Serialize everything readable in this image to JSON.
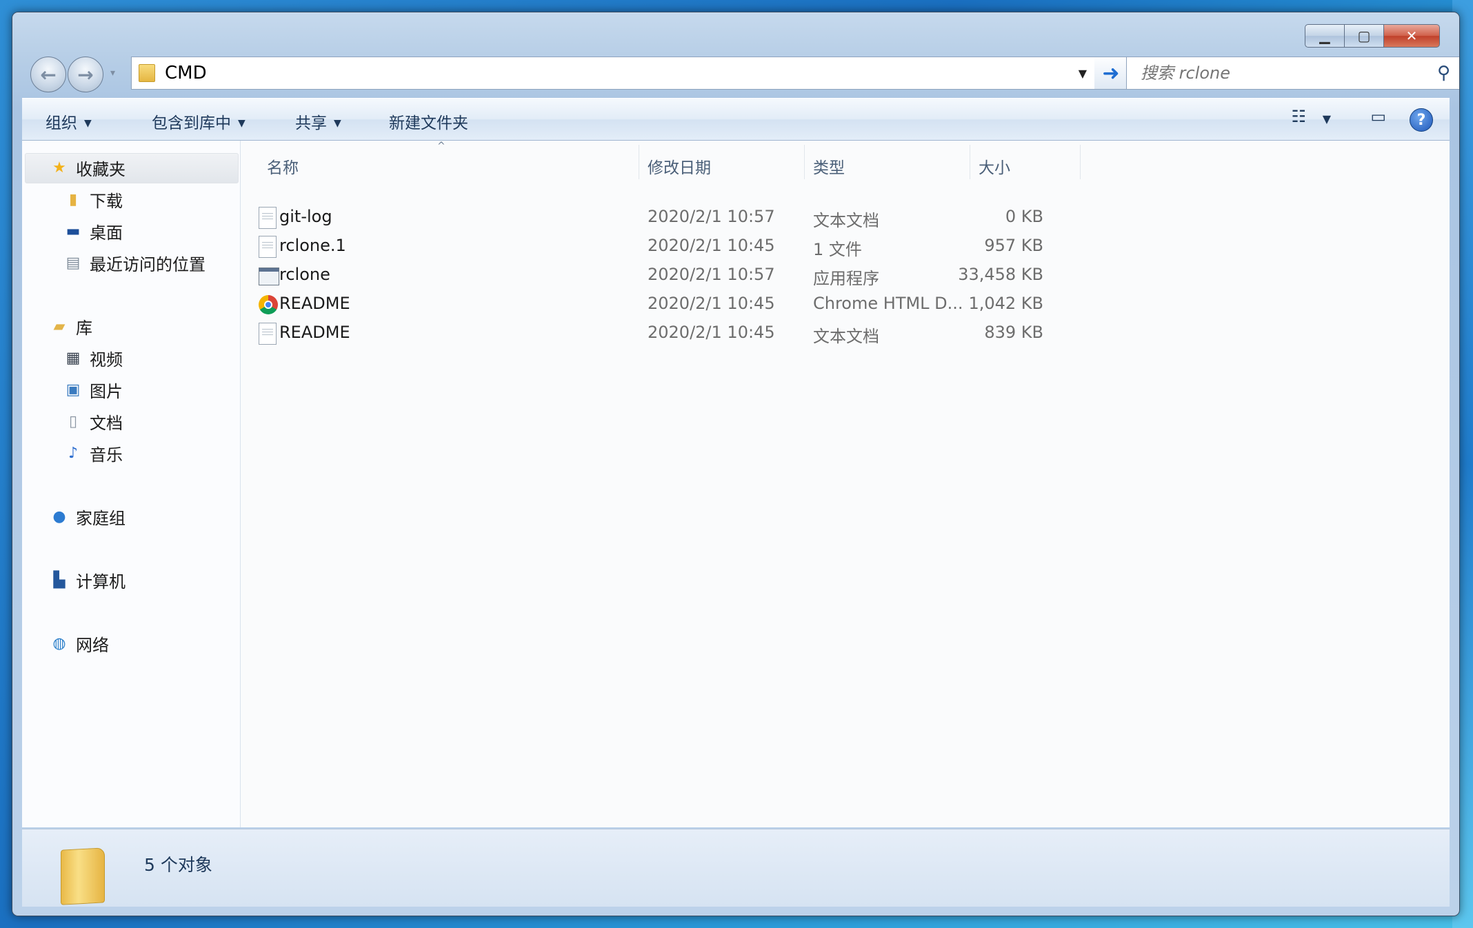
{
  "window": {
    "caption": {
      "minimize": "▁",
      "maximize": "▢",
      "close": "✕"
    }
  },
  "nav": {
    "back_icon": "←",
    "forward_icon": "→",
    "history_dropdown": "▾",
    "address_value": "CMD",
    "address_dropdown": "▼",
    "go_icon": "➜",
    "search_placeholder": "搜索 rclone",
    "search_icon": "⚲"
  },
  "toolbar": {
    "organize": "组织",
    "include_in_library": "包含到库中",
    "share": "共享",
    "new_folder": "新建文件夹",
    "view_icon": "☷",
    "view_caret": "▼",
    "preview_icon": "▭",
    "help_icon": "?"
  },
  "sidebar": {
    "favorites": "收藏夹",
    "downloads": "下载",
    "desktop": "桌面",
    "recent": "最近访问的位置",
    "libraries": "库",
    "videos": "视频",
    "pictures": "图片",
    "documents": "文档",
    "music": "音乐",
    "homegroup": "家庭组",
    "computer": "计算机",
    "network": "网络"
  },
  "columns": {
    "name": "名称",
    "date": "修改日期",
    "type": "类型",
    "size": "大小",
    "sort_indicator": "^"
  },
  "files": [
    {
      "name": "git-log",
      "date": "2020/2/1 10:57",
      "type": "文本文档",
      "size": "0 KB",
      "icon": "text-file-icon"
    },
    {
      "name": "rclone.1",
      "date": "2020/2/1 10:45",
      "type": "1 文件",
      "size": "957 KB",
      "icon": "generic-file-icon"
    },
    {
      "name": "rclone",
      "date": "2020/2/1 10:57",
      "type": "应用程序",
      "size": "33,458 KB",
      "icon": "application-icon"
    },
    {
      "name": "README",
      "date": "2020/2/1 10:45",
      "type": "Chrome HTML D...",
      "size": "1,042 KB",
      "icon": "chrome-icon"
    },
    {
      "name": "README",
      "date": "2020/2/1 10:45",
      "type": "文本文档",
      "size": "839 KB",
      "icon": "text-file-icon"
    }
  ],
  "status": {
    "count_text": "5 个对象"
  }
}
